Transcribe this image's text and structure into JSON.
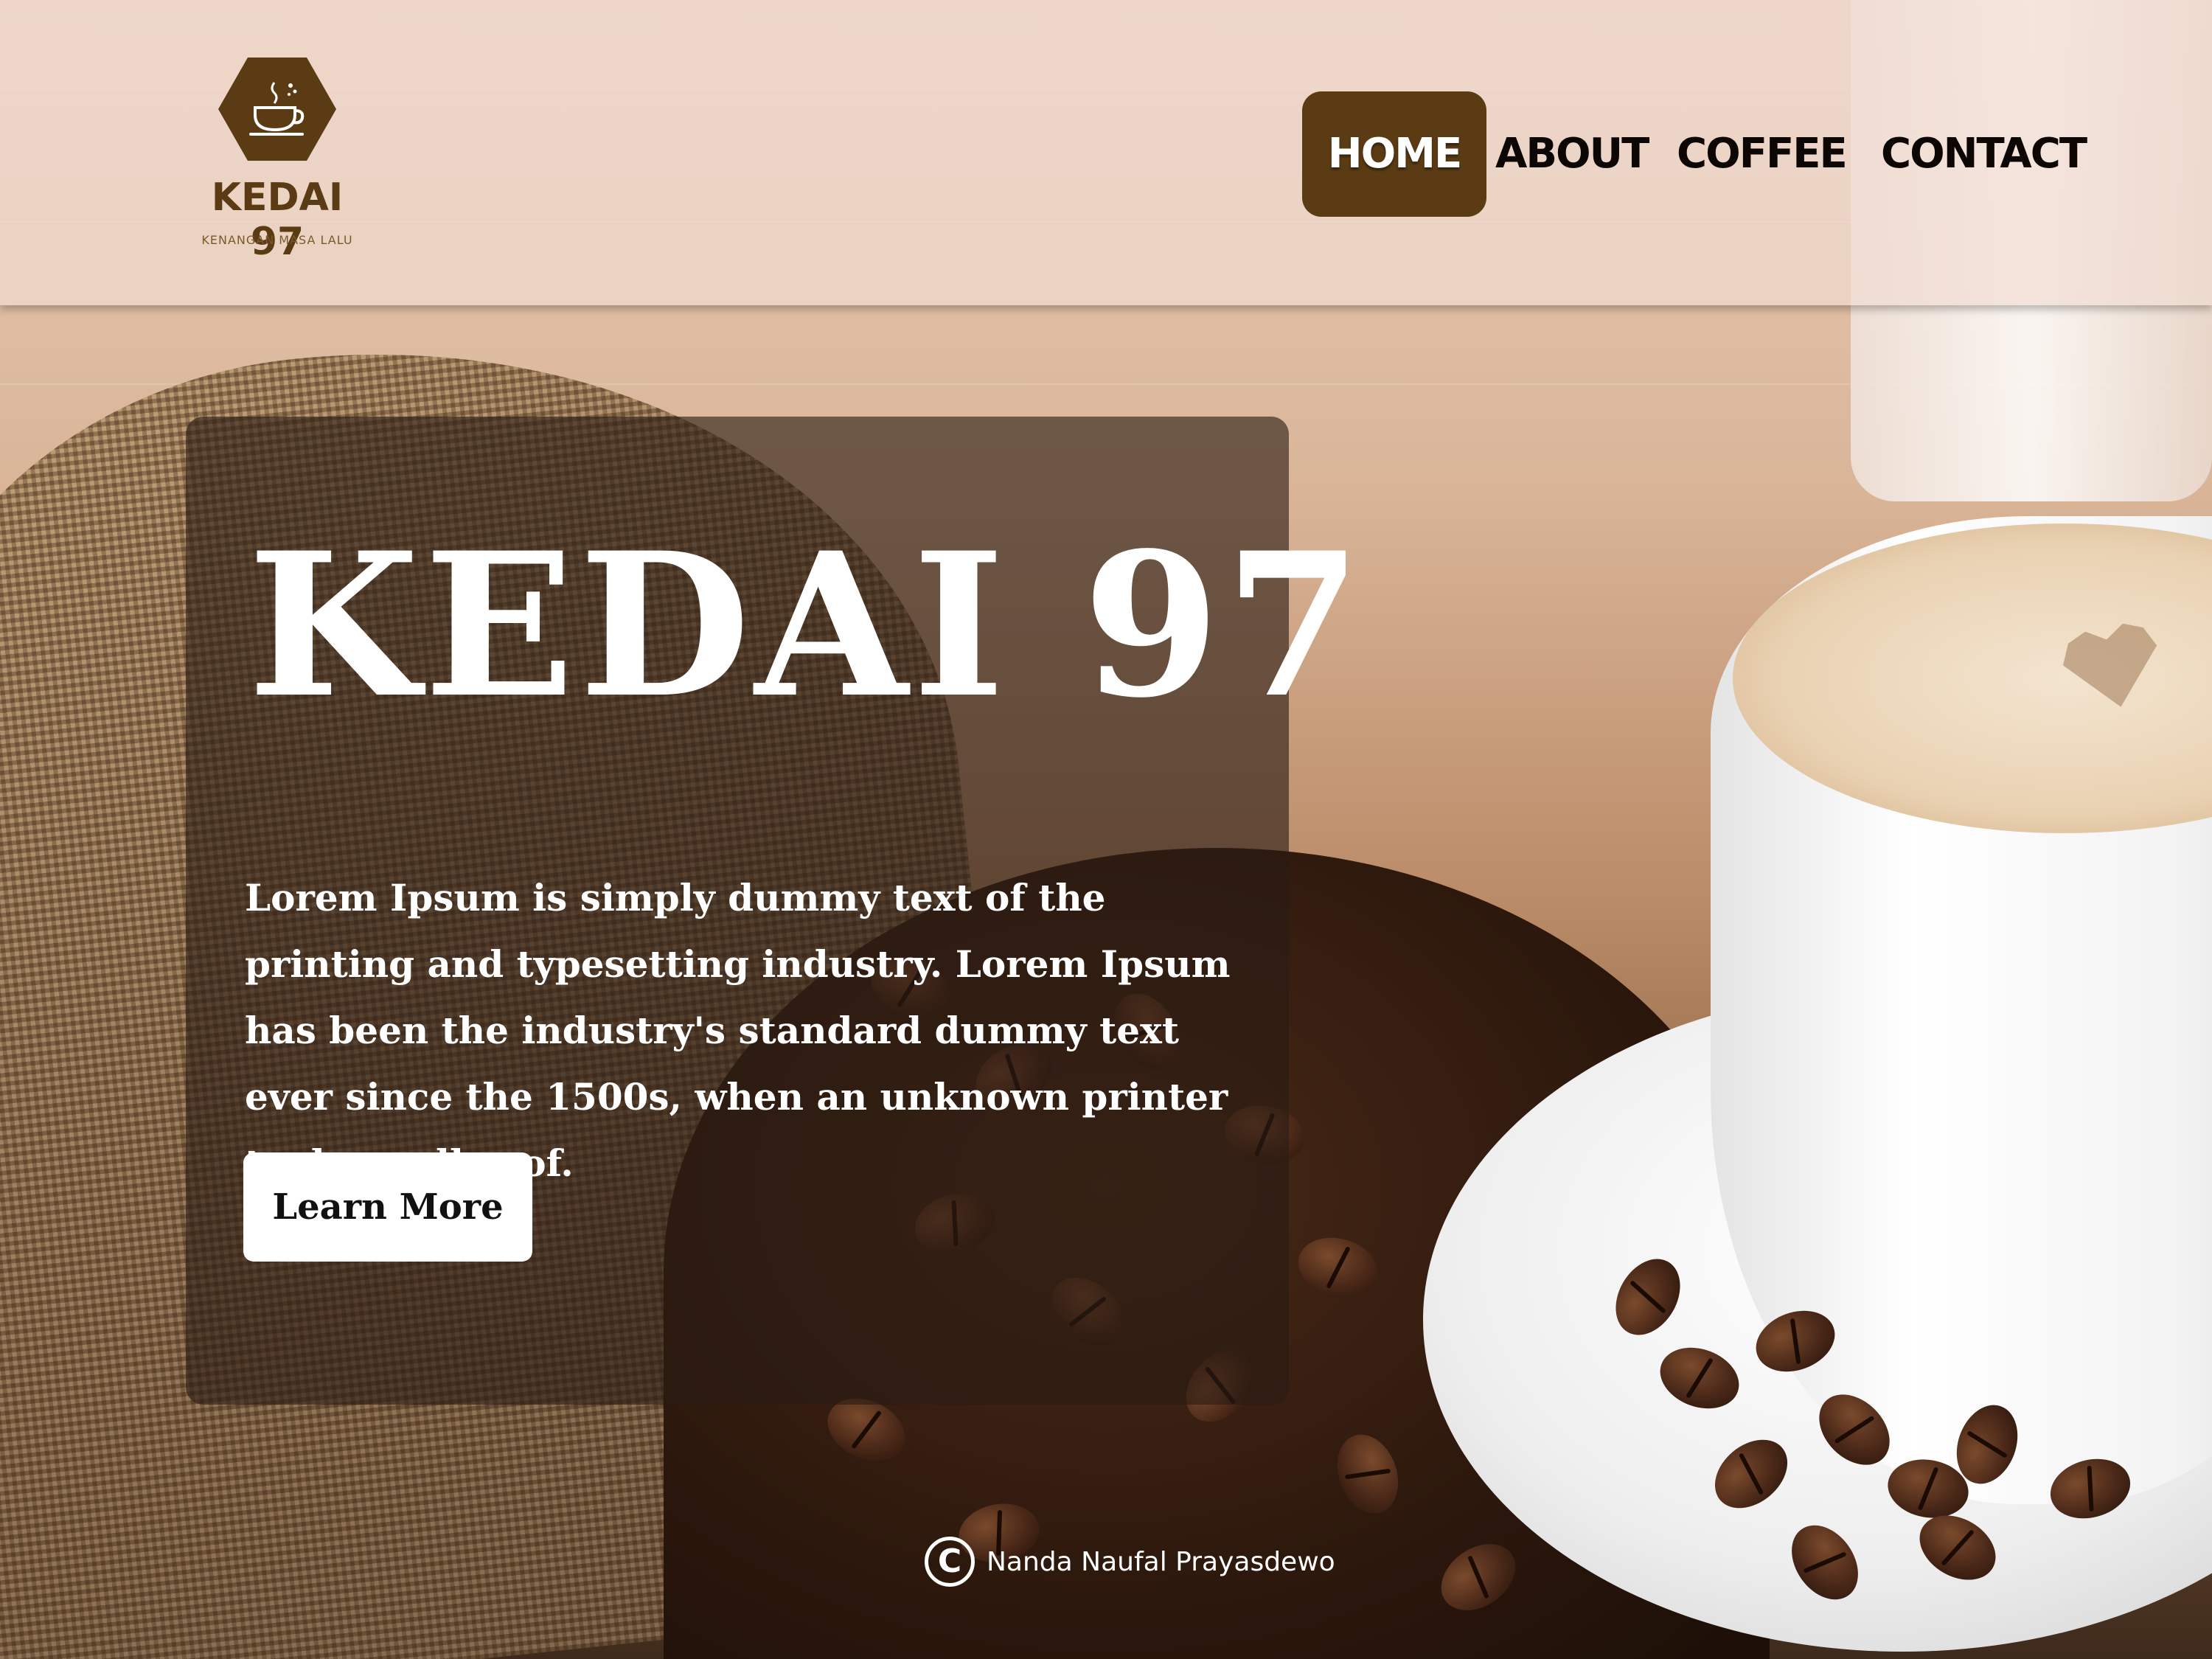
{
  "brand": {
    "name": "KEDAI 97",
    "tagline": "KENANGAN MASA LALU",
    "logo_icon": "coffee-cup-icon",
    "color": "#5a3b14"
  },
  "nav": {
    "items": [
      {
        "label": "HOME",
        "active": true
      },
      {
        "label": "ABOUT",
        "active": false
      },
      {
        "label": "COFFEE",
        "active": false
      },
      {
        "label": "CONTACT",
        "active": false
      }
    ]
  },
  "hero": {
    "title": "KEDAI 97",
    "body": "Lorem Ipsum is simply dummy text of the printing and typesetting industry. Lorem Ipsum has been the industry's standard dummy text ever since the 1500s, when an unknown printer took a galley of.",
    "button_label": "Learn More"
  },
  "footer": {
    "copyright_symbol": "C",
    "author": "Nanda Naufal Prayasdewo"
  }
}
